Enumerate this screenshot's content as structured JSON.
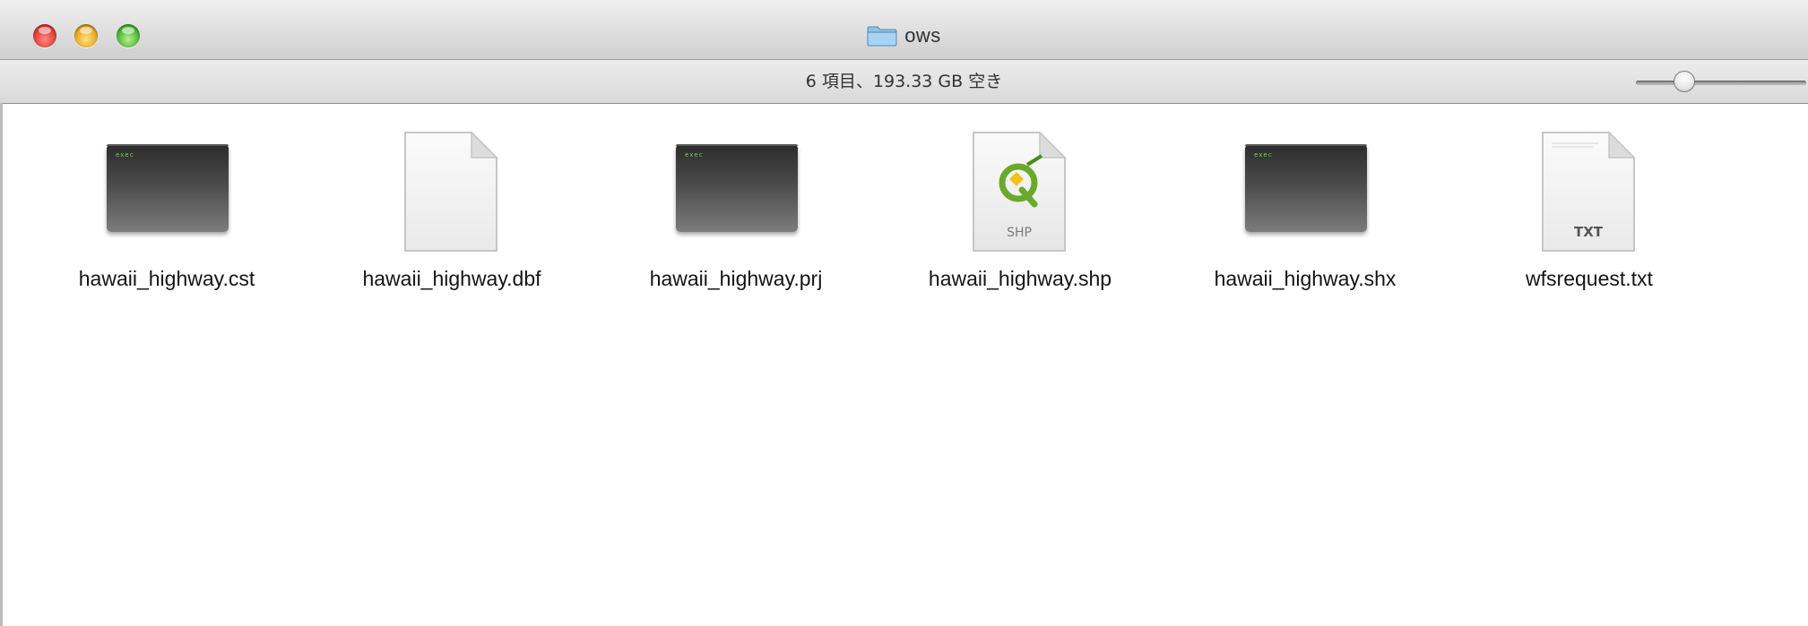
{
  "window": {
    "title": "ows",
    "folder_icon": "folder-icon"
  },
  "status": {
    "text": "6 項目、193.33 GB 空き",
    "zoom_level": 0.25
  },
  "files": [
    {
      "name": "hawaii_highway.cst",
      "icon": "exec-terminal-icon",
      "badge": "exec"
    },
    {
      "name": "hawaii_highway.dbf",
      "icon": "blank-document-icon",
      "badge": ""
    },
    {
      "name": "hawaii_highway.prj",
      "icon": "exec-terminal-icon",
      "badge": "exec"
    },
    {
      "name": "hawaii_highway.shp",
      "icon": "qgis-shp-document-icon",
      "badge": "SHP"
    },
    {
      "name": "hawaii_highway.shx",
      "icon": "exec-terminal-icon",
      "badge": "exec"
    },
    {
      "name": "wfsrequest.txt",
      "icon": "text-document-icon",
      "badge": "TXT"
    }
  ],
  "colors": {
    "close": "#e0413a",
    "minimize": "#e8a92a",
    "zoom": "#4fb83a",
    "exec_label": "#7dd35a",
    "qgis_green": "#6aa92c"
  }
}
